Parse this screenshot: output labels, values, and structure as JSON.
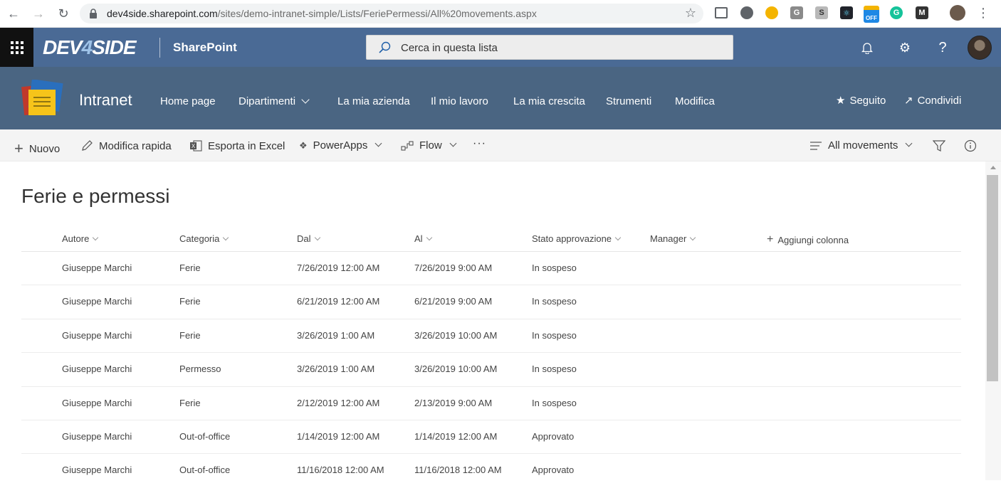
{
  "browser": {
    "url_domain": "dev4side.sharepoint.com",
    "url_path": "/sites/demo-intranet-simple/Lists/FeriePermessi/All%20movements.aspx",
    "ext_g": "G",
    "ext_s": "S",
    "ext_off": "OFF",
    "ext_grammarly": "G"
  },
  "suitebar": {
    "logo": "DEV",
    "logo_four": "4",
    "logo_end": "SIDE",
    "app_name": "SharePoint",
    "search_placeholder": "Cerca in questa lista"
  },
  "site": {
    "name": "Intranet",
    "nav": [
      {
        "label": "Home page"
      },
      {
        "label": "Dipartimenti"
      },
      {
        "label": "La mia azienda"
      },
      {
        "label": "Il mio lavoro"
      },
      {
        "label": "La mia crescita"
      },
      {
        "label": "Strumenti"
      },
      {
        "label": "Modifica"
      }
    ],
    "follow_label": "Seguito",
    "share_label": "Condividi"
  },
  "commandbar": {
    "new_label": "Nuovo",
    "quick_edit_label": "Modifica rapida",
    "export_label": "Esporta in Excel",
    "powerapps_label": "PowerApps",
    "flow_label": "Flow",
    "more_label": "···",
    "view_label": "All movements"
  },
  "list": {
    "title": "Ferie e permessi",
    "columns": [
      {
        "label": "Autore"
      },
      {
        "label": "Categoria"
      },
      {
        "label": "Dal"
      },
      {
        "label": "Al"
      },
      {
        "label": "Stato approvazione"
      },
      {
        "label": "Manager"
      }
    ],
    "add_column_label": "Aggiungi colonna",
    "rows": [
      {
        "autore": "Giuseppe Marchi",
        "categoria": "Ferie",
        "dal": "7/26/2019 12:00 AM",
        "al": "7/26/2019 9:00 AM",
        "stato": "In sospeso",
        "manager": ""
      },
      {
        "autore": "Giuseppe Marchi",
        "categoria": "Ferie",
        "dal": "6/21/2019 12:00 AM",
        "al": "6/21/2019 9:00 AM",
        "stato": "In sospeso",
        "manager": ""
      },
      {
        "autore": "Giuseppe Marchi",
        "categoria": "Ferie",
        "dal": "3/26/2019 1:00 AM",
        "al": "3/26/2019 10:00 AM",
        "stato": "In sospeso",
        "manager": ""
      },
      {
        "autore": "Giuseppe Marchi",
        "categoria": "Permesso",
        "dal": "3/26/2019 1:00 AM",
        "al": "3/26/2019 10:00 AM",
        "stato": "In sospeso",
        "manager": ""
      },
      {
        "autore": "Giuseppe Marchi",
        "categoria": "Ferie",
        "dal": "2/12/2019 12:00 AM",
        "al": "2/13/2019 9:00 AM",
        "stato": "In sospeso",
        "manager": ""
      },
      {
        "autore": "Giuseppe Marchi",
        "categoria": "Out-of-office",
        "dal": "1/14/2019 12:00 AM",
        "al": "1/14/2019 12:00 AM",
        "stato": "Approvato",
        "manager": ""
      },
      {
        "autore": "Giuseppe Marchi",
        "categoria": "Out-of-office",
        "dal": "11/16/2018 12:00 AM",
        "al": "11/16/2018 12:00 AM",
        "stato": "Approvato",
        "manager": ""
      }
    ]
  }
}
